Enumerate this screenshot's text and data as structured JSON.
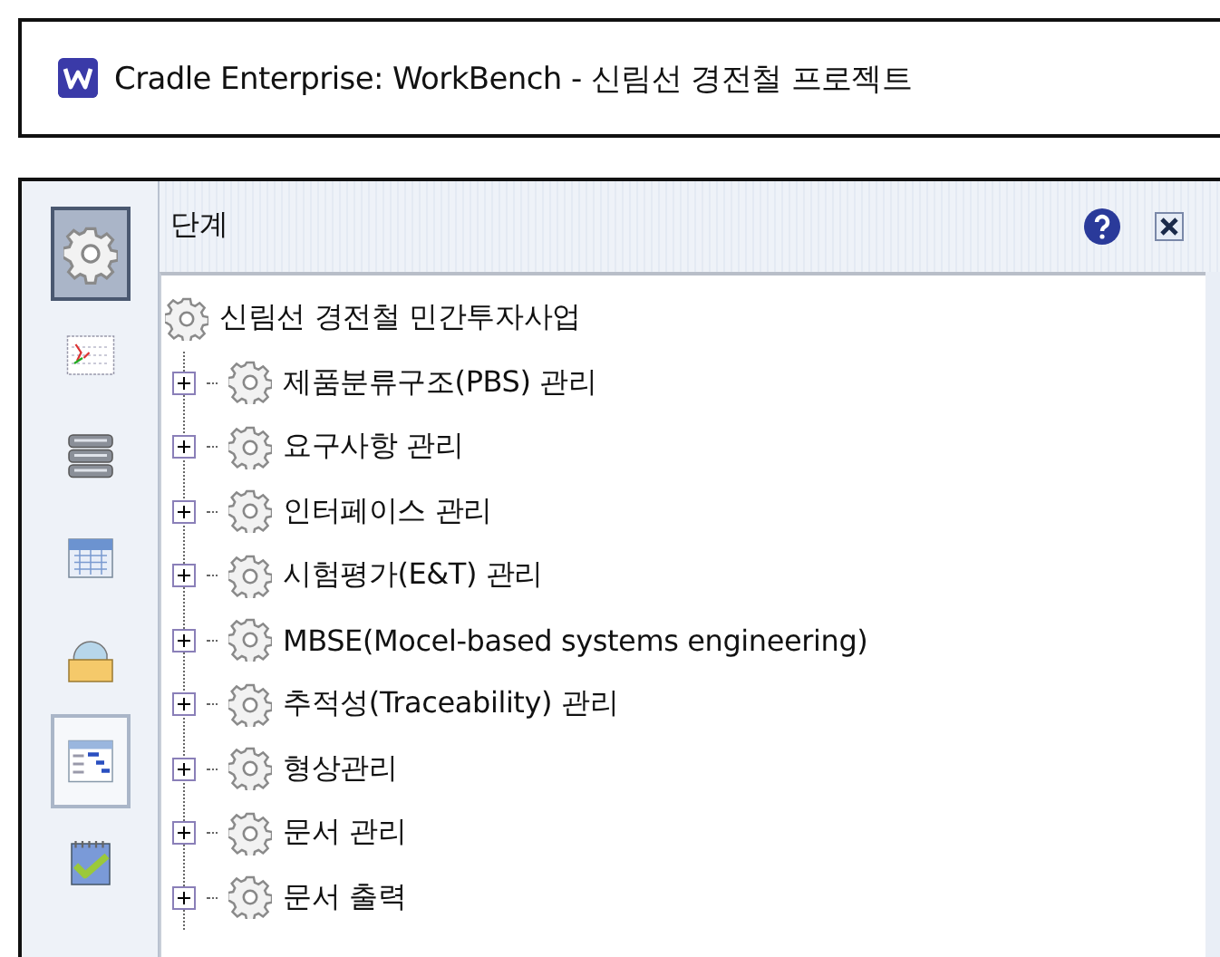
{
  "window": {
    "title": "Cradle Enterprise: WorkBench - 신림선 경전철 프로젝트"
  },
  "sidebar": {
    "items": [
      {
        "kind": "gear",
        "selected": true,
        "highlighted": false
      },
      {
        "kind": "grid",
        "selected": false,
        "highlighted": false
      },
      {
        "kind": "database",
        "selected": false,
        "highlighted": false
      },
      {
        "kind": "calendar",
        "selected": false,
        "highlighted": false
      },
      {
        "kind": "folder",
        "selected": false,
        "highlighted": false
      },
      {
        "kind": "gantt",
        "selected": false,
        "highlighted": true
      },
      {
        "kind": "checklist",
        "selected": false,
        "highlighted": false
      }
    ]
  },
  "panel": {
    "title": "단계",
    "tree": {
      "label": "신림선 경전철 민간투자사업",
      "children": [
        {
          "label": "제품분류구조(PBS) 관리",
          "expanded": false
        },
        {
          "label": "요구사항 관리",
          "expanded": false
        },
        {
          "label": "인터페이스 관리",
          "expanded": false
        },
        {
          "label": "시험평가(E&T) 관리",
          "expanded": false
        },
        {
          "label": "MBSE(Mocel-based systems engineering)",
          "expanded": false
        },
        {
          "label": "추적성(Traceability) 관리",
          "expanded": false
        },
        {
          "label": "형상관리",
          "expanded": false
        },
        {
          "label": "문서 관리",
          "expanded": false
        },
        {
          "label": "문서 출력",
          "expanded": false
        }
      ]
    }
  }
}
